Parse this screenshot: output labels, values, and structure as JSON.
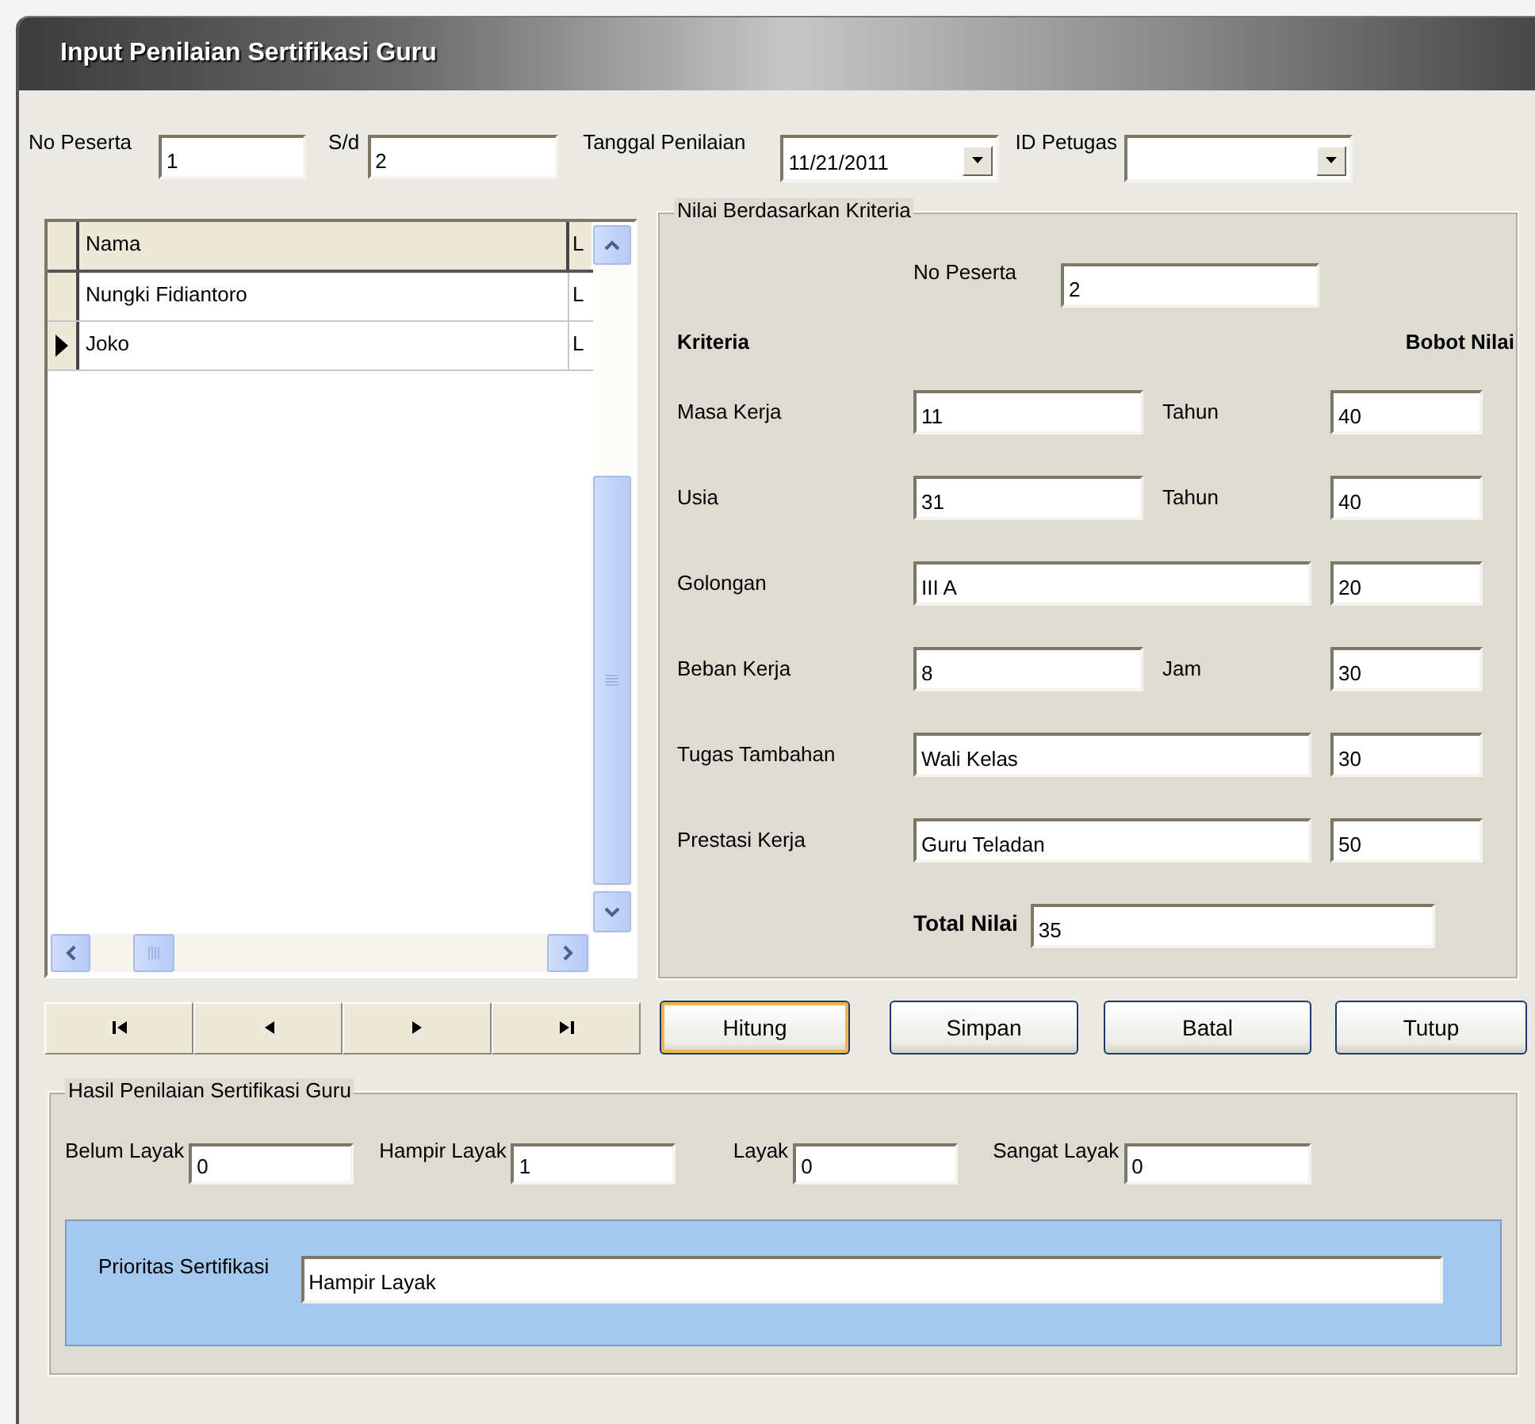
{
  "window": {
    "title": "Input Penilaian Sertifikasi Guru"
  },
  "filter": [
    {
      "label": "No Peserta",
      "value": "1",
      "kind": "text"
    },
    {
      "label": "S/d",
      "value": "2",
      "kind": "text"
    },
    {
      "label": "Tanggal Penilaian",
      "value": "11/21/2011",
      "kind": "dropdown"
    },
    {
      "label": "ID Petugas",
      "kind": "dropdown"
    }
  ],
  "grid": {
    "columns": [
      "Nama",
      "L"
    ],
    "rows": [
      {
        "cells": [
          "Nungki Fidiantoro",
          "L"
        ],
        "selected": false
      },
      {
        "cells": [
          "Joko",
          "L"
        ],
        "selected": true
      }
    ]
  },
  "criteria_panel": {
    "title": "Nilai Berdasarkan Kriteria",
    "no_peserta": {
      "label": "No Peserta",
      "value": "2"
    },
    "headings": [
      "Kriteria",
      "Bobot Nilai"
    ],
    "rows": [
      {
        "label": "Masa Kerja",
        "value": "11",
        "unit": "Tahun",
        "score": "40"
      },
      {
        "label": "Usia",
        "value": "31",
        "unit": "Tahun",
        "score": "40"
      },
      {
        "label": "Golongan",
        "value": "III A",
        "score": "20"
      },
      {
        "label": "Beban Kerja",
        "value": "8",
        "unit": "Jam",
        "score": "30"
      },
      {
        "label": "Tugas Tambahan",
        "value": "Wali Kelas",
        "score": "30"
      },
      {
        "label": "Prestasi Kerja",
        "value": "Guru Teladan",
        "score": "50"
      }
    ],
    "total": {
      "label": "Total Nilai",
      "value": "35"
    }
  },
  "navigator": [
    {
      "kind": "first"
    },
    {
      "kind": "previous"
    },
    {
      "kind": "next"
    },
    {
      "kind": "last"
    }
  ],
  "buttons": [
    {
      "label": "Hitung",
      "focused": true
    },
    {
      "label": "Simpan",
      "focused": false
    },
    {
      "label": "Batal",
      "focused": false
    },
    {
      "label": "Tutup",
      "focused": false
    }
  ],
  "result_panel": {
    "title": "Hasil Penilaian Sertifikasi Guru",
    "counts": [
      {
        "label": "Belum Layak",
        "value": "0"
      },
      {
        "label": "Hampir Layak",
        "value": "1"
      },
      {
        "label": "Layak",
        "value": "0"
      },
      {
        "label": "Sangat Layak",
        "value": "0"
      }
    ],
    "priority": {
      "label": "Prioritas Sertifikasi",
      "value": "Hampir Layak"
    }
  }
}
